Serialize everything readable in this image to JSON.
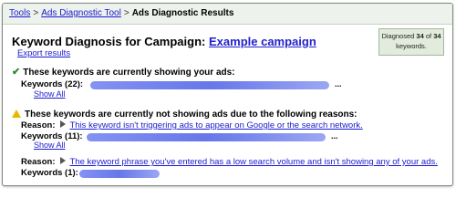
{
  "breadcrumb": {
    "tools": "Tools",
    "sep1": ">",
    "diagnostic_tool": "Ads Diagnostic Tool",
    "sep2": ">",
    "current": "Ads Diagnostic Results"
  },
  "header": {
    "title_prefix": "Keyword Diagnosis for Campaign:",
    "campaign_name": "Example campaign",
    "export_label": "Export results"
  },
  "summary": {
    "diagnosed_prefix": "Diagnosed",
    "diagnosed_count": "34",
    "of": "of",
    "total_count": "34",
    "suffix": "keywords."
  },
  "showing": {
    "heading": "These keywords are currently showing your ads:",
    "keywords_label": "Keywords (22):",
    "show_all": "Show All",
    "ellipsis": "..."
  },
  "not_showing": {
    "heading": "These keywords are currently not showing ads due to the following reasons:",
    "reasons": [
      {
        "reason_label": "Reason:",
        "reason_text": "This keyword isn't triggering ads to appear on Google or the search network.",
        "keywords_label": "Keywords (11):",
        "show_all": "Show All",
        "ellipsis": "..."
      },
      {
        "reason_label": "Reason:",
        "reason_text": "The keyword phrase you've entered has a low search volume and isn't showing any of your ads.",
        "keywords_label": "Keywords (1):"
      }
    ]
  },
  "colors": {
    "link": "#1a1ad0",
    "redaction": "#4b5fe6",
    "warning": "#e8b800",
    "check": "#2a8a2a",
    "summary_bg": "#e2ecdd"
  }
}
